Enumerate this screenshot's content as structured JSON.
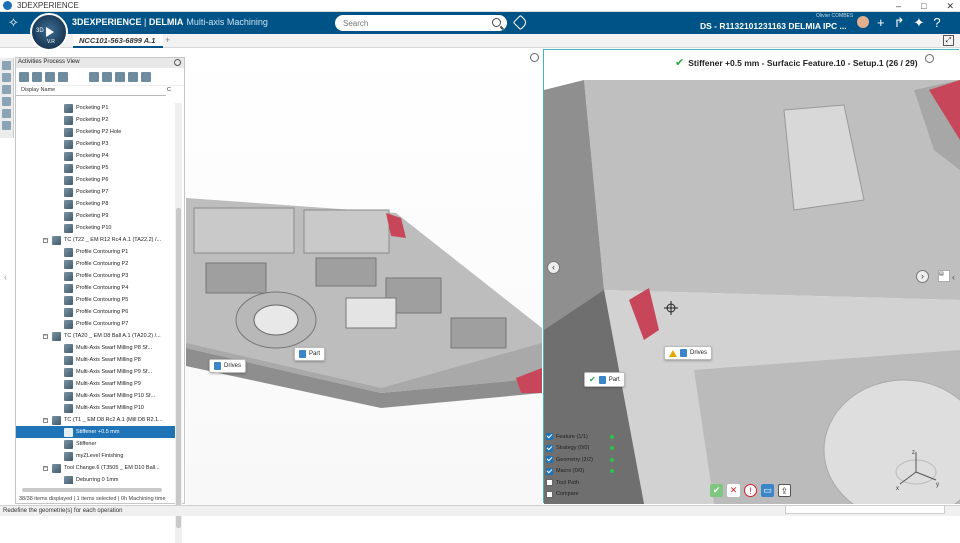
{
  "window": {
    "title": "3DEXPERIENCE",
    "controls": [
      "–",
      "□",
      "✕"
    ]
  },
  "topbar": {
    "brand_bold": "3DEXPERIENCE",
    "brand_sep": " | ",
    "brand_product": "DELMIA",
    "brand_app": "Multi-axis Machining",
    "compass_label": "3D",
    "compass_version": "V.R",
    "search_placeholder": "Search",
    "user_name": "Olivier COMBES",
    "credentials": "DS - R1132101231163 DELMIA IPC ..."
  },
  "tabs": [
    {
      "label": "NCC101-563-6899 A.1"
    }
  ],
  "tab_add": "+",
  "panel": {
    "title": "Activities Process View",
    "column_display_name": "Display Name",
    "column_c": "C",
    "status": "38/38 items displayed | 1 items selected | 0h Machining time"
  },
  "tree": [
    {
      "label": "Pocketing P1",
      "level": 2
    },
    {
      "label": "Pocketing P2",
      "level": 2
    },
    {
      "label": "Pocketing P2 Hole",
      "level": 2
    },
    {
      "label": "Pocketing P3",
      "level": 2
    },
    {
      "label": "Pocketing P4",
      "level": 2
    },
    {
      "label": "Pocketing P5",
      "level": 2
    },
    {
      "label": "Pocketing P6",
      "level": 2
    },
    {
      "label": "Pocketing P7",
      "level": 2
    },
    {
      "label": "Pocketing P8",
      "level": 2
    },
    {
      "label": "Pocketing P9",
      "level": 2
    },
    {
      "label": "Pocketing P10",
      "level": 2
    },
    {
      "label": "TC (T22 _ EM R12 Rc4 A.1 (TA22.2) /...",
      "level": 1
    },
    {
      "label": "Profile Contouring P1",
      "level": 2
    },
    {
      "label": "Profile Contouring P2",
      "level": 2
    },
    {
      "label": "Profile Contouring P3",
      "level": 2
    },
    {
      "label": "Profile Contouring P4",
      "level": 2
    },
    {
      "label": "Profile Contouring P5",
      "level": 2
    },
    {
      "label": "Profile Contouring P6",
      "level": 2
    },
    {
      "label": "Profile Contouring P7",
      "level": 2
    },
    {
      "label": "TC (TA20 _ EM D8 Ball A.1 (TA20.2) /...",
      "level": 1
    },
    {
      "label": "Multi-Axis Swarf Milling P8 Sf...",
      "level": 2
    },
    {
      "label": "Multi-Axis Swarf Milling P8",
      "level": 2
    },
    {
      "label": "Multi-Axis Swarf Milling P9 Sf...",
      "level": 2
    },
    {
      "label": "Multi-Axis Swarf Milling P9",
      "level": 2
    },
    {
      "label": "Multi-Axis Swarf Milling P10 Sf...",
      "level": 2
    },
    {
      "label": "Multi-Axis Swarf Milling P10",
      "level": 2
    },
    {
      "label": "TC (T1 _ EM D8 Rc2 A.1 (Mill D8 R2.1...",
      "level": 1
    },
    {
      "label": "Stiffener +0.5 mm",
      "level": 2,
      "selected": true
    },
    {
      "label": "Stiffener",
      "level": 2
    },
    {
      "label": "myZLevel Finishing",
      "level": 2
    },
    {
      "label": "Tool Change.6 (T3505 _ EM D10 Ball...",
      "level": 1
    },
    {
      "label": "Deburring 0 1mm",
      "level": 2
    }
  ],
  "viewport_left": {
    "label_drives": "Drives",
    "label_part": "Part"
  },
  "viewport_right": {
    "banner": "Stiffener +0.5 mm  - Surfacic Feature.10 - Setup.1 (26 / 29)",
    "label_drives": "Drives",
    "label_part": "Part",
    "checks": [
      {
        "label": "Feature (1/1)",
        "checked": true,
        "ok": true
      },
      {
        "label": "Strategy (0/0)",
        "checked": true,
        "ok": true
      },
      {
        "label": "Geometry (2/2)",
        "checked": true,
        "ok": true
      },
      {
        "label": "Macro (0/0)",
        "checked": true,
        "ok": true
      },
      {
        "label": "Tool Path",
        "checked": false,
        "ok": false
      },
      {
        "label": "Compare",
        "checked": false,
        "ok": false
      }
    ],
    "compass_axes": [
      "z",
      "x",
      "y"
    ]
  },
  "statusbar": {
    "message": "Redefine the geometrie(s) for each operation"
  },
  "colors": {
    "topbar": "#005386",
    "selection": "#1f74b8",
    "ok": "#2cc24b",
    "stiffener": "#c8465a"
  }
}
